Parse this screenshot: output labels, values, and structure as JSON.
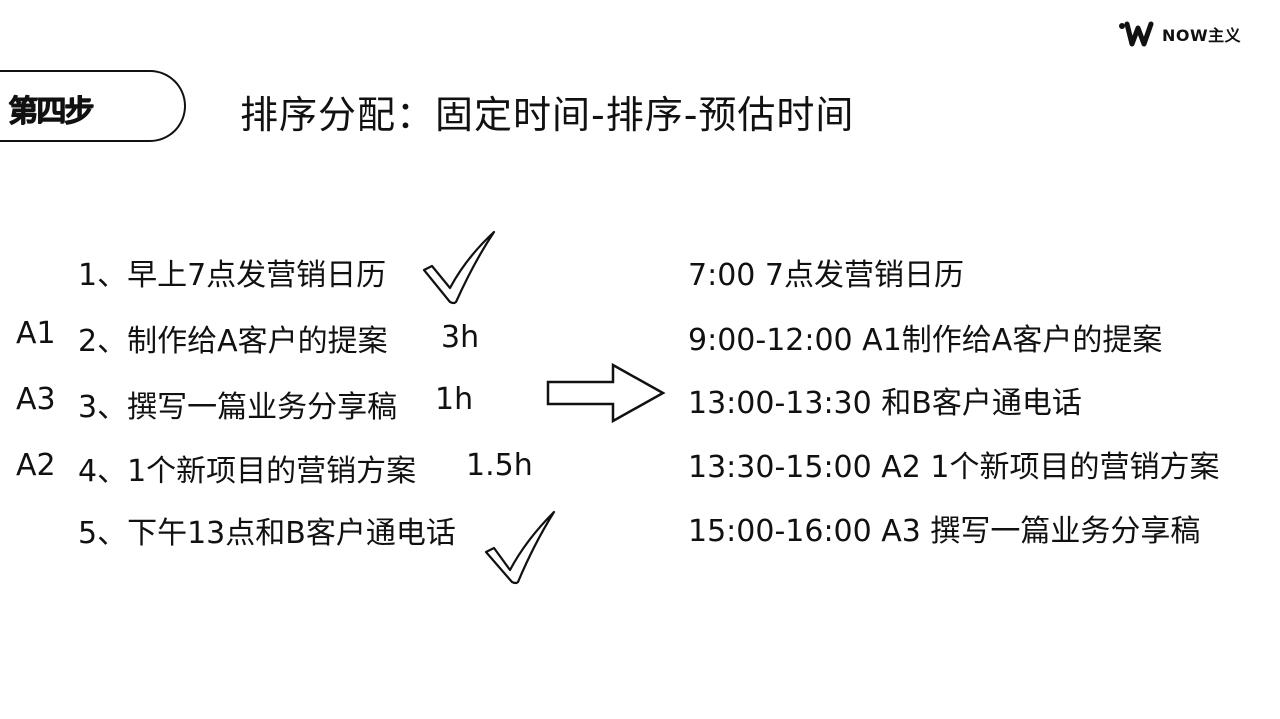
{
  "brand": {
    "name": "NOW主义"
  },
  "step": {
    "label": "第四步"
  },
  "title": "排序分配：固定时间-排序-预估时间",
  "tasks": [
    {
      "code": "",
      "text": "1、早上7点发营销日历",
      "duration": "",
      "checked": true
    },
    {
      "code": "A1",
      "text": "2、制作给A客户的提案",
      "duration": "3h",
      "checked": false
    },
    {
      "code": "A3",
      "text": "3、撰写一篇业务分享稿",
      "duration": "1h",
      "checked": false
    },
    {
      "code": "A2",
      "text": "4、1个新项目的营销方案",
      "duration": "1.5h",
      "checked": false
    },
    {
      "code": "",
      "text": "5、下午13点和B客户通电话",
      "duration": "",
      "checked": true
    }
  ],
  "schedule": [
    "7:00 7点发营销日历",
    "9:00-12:00  A1制作给A客户的提案",
    "13:00-13:30 和B客户通电话",
    "13:30-15:00 A2 1个新项目的营销方案",
    "15:00-16:00 A3 撰写一篇业务分享稿"
  ],
  "icons": {
    "logo": "now-wave-logo-icon",
    "check": "check-mark-icon",
    "arrow": "right-arrow-icon"
  }
}
